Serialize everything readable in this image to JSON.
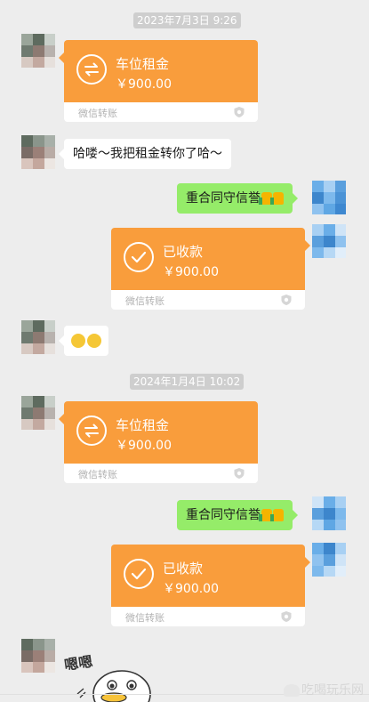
{
  "colors": {
    "background": "#ededed",
    "transfer_orange": "#f99d3c",
    "sent_green": "#95ec69",
    "timestamp_bg": "#cecece"
  },
  "timestamps": [
    "2023年7月3日 9:26",
    "2024年1月4日 10:02"
  ],
  "transfers": [
    {
      "title": "车位租金",
      "amount": "￥900.00",
      "footer": "微信转账",
      "icon": "exchange-icon",
      "side": "left"
    },
    {
      "title": "已收款",
      "amount": "￥900.00",
      "footer": "微信转账",
      "icon": "check-icon",
      "side": "right"
    },
    {
      "title": "车位租金",
      "amount": "￥900.00",
      "footer": "微信转账",
      "icon": "exchange-icon",
      "side": "left"
    },
    {
      "title": "已收款",
      "amount": "￥900.00",
      "footer": "微信转账",
      "icon": "check-icon",
      "side": "right"
    }
  ],
  "messages": {
    "left_text_1": "哈喽～我把租金转你了哈～",
    "right_text_1": "重合同守信誉",
    "right_text_2": "重合同守信誉"
  },
  "sticker_text": "嗯嗯",
  "watermark": "吃喝玩乐网"
}
